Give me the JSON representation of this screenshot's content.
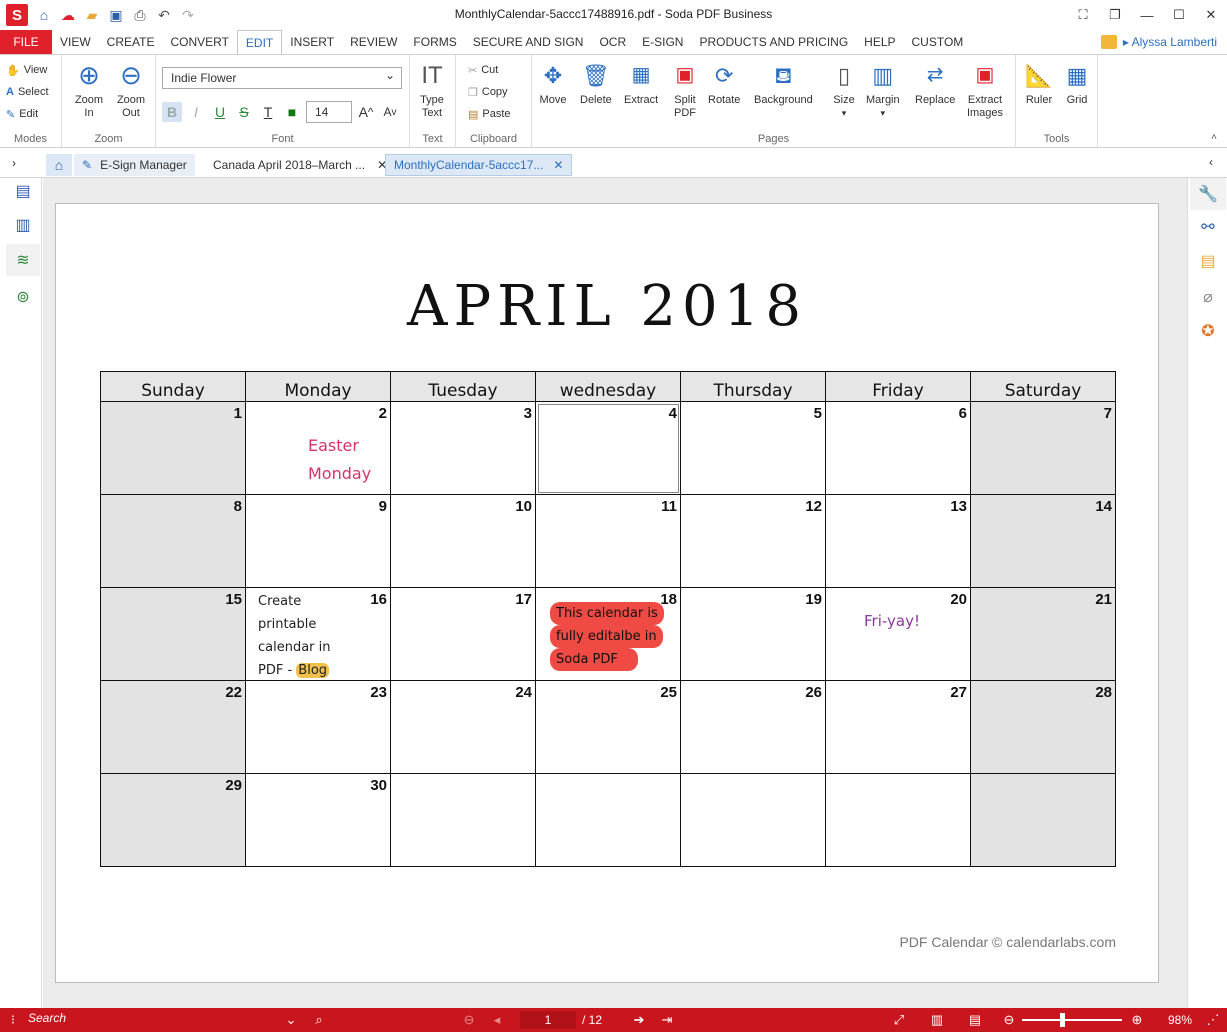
{
  "titlebar": {
    "app_logo": "S",
    "title": "MonthlyCalendar-5accc17488916.pdf   -   Soda PDF Business"
  },
  "menu": {
    "file": "FILE",
    "items": [
      "VIEW",
      "CREATE",
      "CONVERT",
      "EDIT",
      "INSERT",
      "REVIEW",
      "FORMS",
      "SECURE AND SIGN",
      "OCR",
      "E-SIGN",
      "PRODUCTS AND PRICING",
      "HELP",
      "CUSTOM"
    ],
    "active": "EDIT",
    "user": "Alyssa Lamberti"
  },
  "ribbon": {
    "modes": {
      "view": "View",
      "select": "Select",
      "edit": "Edit",
      "label": "Modes"
    },
    "zoom": {
      "zoom_in": "Zoom In",
      "zoom_out": "Zoom Out",
      "label": "Zoom"
    },
    "font": {
      "family": "Indie Flower",
      "size": "14",
      "label": "Font"
    },
    "text": {
      "type_text": "Type Text",
      "label": "Text"
    },
    "clipboard": {
      "cut": "Cut",
      "copy": "Copy",
      "paste": "Paste",
      "label": "Clipboard"
    },
    "pages": {
      "move": "Move",
      "delete": "Delete",
      "extract": "Extract",
      "split": "Split PDF",
      "rotate": "Rotate",
      "background": "Background",
      "size": "Size",
      "margin": "Margin",
      "replace": "Replace",
      "extract_images": "Extract Images",
      "label": "Pages"
    },
    "tools": {
      "ruler": "Ruler",
      "grid": "Grid",
      "label": "Tools"
    }
  },
  "tabs": [
    {
      "label": "E-Sign Manager"
    },
    {
      "label": "Canada April 2018–March ..."
    },
    {
      "label": "MonthlyCalendar-5accc17..."
    }
  ],
  "calendar": {
    "title": "APRIL   2018",
    "weekdays": [
      "Sunday",
      "Monday",
      "Tuesday",
      "wednesday",
      "Thursday",
      "Friday",
      "Saturday"
    ],
    "weeks": [
      [
        "1",
        "2",
        "3",
        "4",
        "5",
        "6",
        "7"
      ],
      [
        "8",
        "9",
        "10",
        "11",
        "12",
        "13",
        "14"
      ],
      [
        "15",
        "16",
        "17",
        "18",
        "19",
        "20",
        "21"
      ],
      [
        "22",
        "23",
        "24",
        "25",
        "26",
        "27",
        "28"
      ],
      [
        "29",
        "30",
        "",
        "",
        "",
        "",
        ""
      ]
    ],
    "notes": {
      "easter_line1": "Easter",
      "easter_line2": "Monday",
      "blog_line1": "Create",
      "blog_line2": "printable",
      "blog_line3": "calendar in",
      "blog_line4": "PDF - ",
      "blog_hl": "Blog",
      "edit_line1": "This calendar is",
      "edit_line2": "fully editalbe in",
      "edit_line3": "Soda PDF",
      "friyay": "Fri-yay!"
    },
    "footer": "PDF Calendar © calendarlabs.com"
  },
  "status": {
    "search_placeholder": "Search",
    "current_page": "1",
    "total_pages": "/ 12",
    "zoom": "98%"
  },
  "colors": {
    "accent_red": "#e0202a",
    "link_blue": "#2d6fc1",
    "easter_pink": "#d4336b",
    "friyay_purple": "#8a3a9a"
  }
}
